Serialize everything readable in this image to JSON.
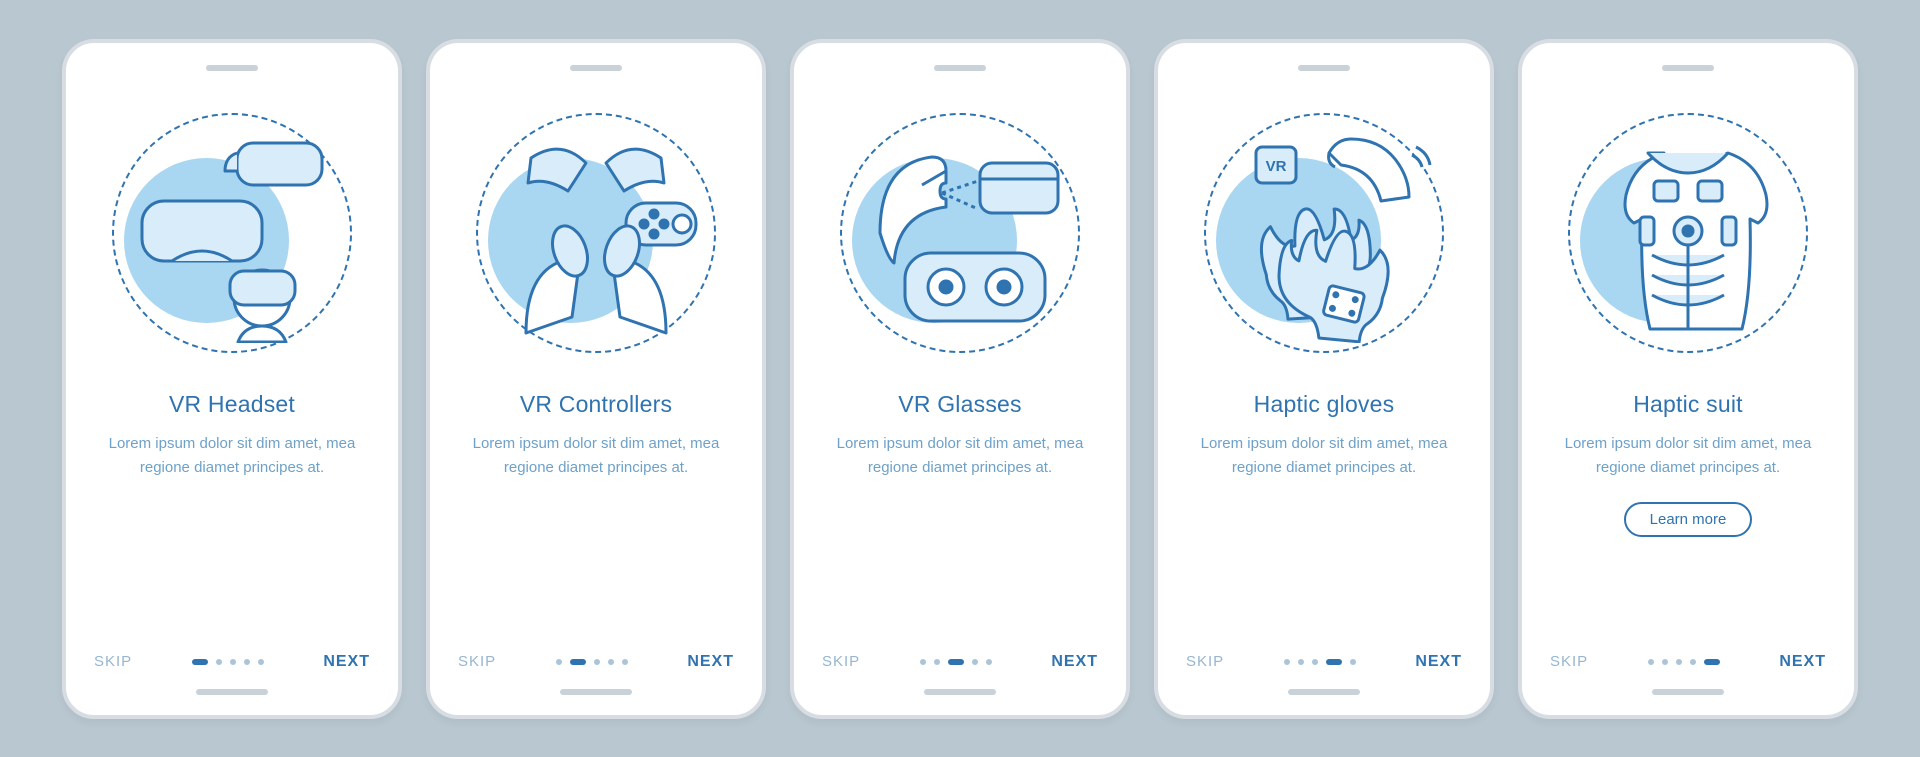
{
  "common": {
    "skip_label": "SKIP",
    "next_label": "NEXT",
    "learn_more_label": "Learn more",
    "description": "Lorem ipsum dolor sit dim amet, mea regione diamet principes at."
  },
  "screens": [
    {
      "title": "VR Headset",
      "icon": "vr-headset-icon",
      "active_dot": 0,
      "has_learn_more": false
    },
    {
      "title": "VR Controllers",
      "icon": "vr-controllers-icon",
      "active_dot": 1,
      "has_learn_more": false
    },
    {
      "title": "VR Glasses",
      "icon": "vr-glasses-icon",
      "active_dot": 2,
      "has_learn_more": false
    },
    {
      "title": "Haptic gloves",
      "icon": "haptic-gloves-icon",
      "active_dot": 3,
      "has_learn_more": false
    },
    {
      "title": "Haptic suit",
      "icon": "haptic-suit-icon",
      "active_dot": 4,
      "has_learn_more": true
    }
  ],
  "colors": {
    "primary": "#2f73b0",
    "accent_fill": "#a9d6f0",
    "muted": "#97b6cf",
    "background": "#b9c7d1"
  }
}
